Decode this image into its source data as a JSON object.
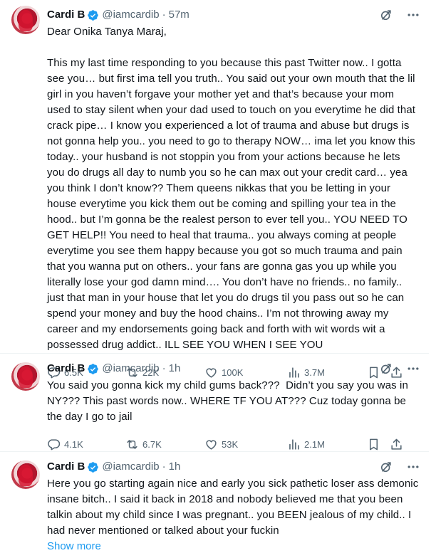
{
  "tweets": [
    {
      "author": "Cardi B",
      "handle": "@iamcardib",
      "separator": "·",
      "time": "57m",
      "text": "Dear Onika Tanya Maraj,\n\nThis my last time responding to you because this past Twitter now.. I gotta see you… but first ima tell you truth.. You said out your own mouth that the lil girl in you haven’t forgave your mother yet and that’s because your mom used to stay silent when your dad used to touch on you everytime he did that crack pipe… I know you experienced a lot of trauma and abuse but drugs is not gonna help you.. you need to go to therapy NOW… ima let you know this today.. your husband is not stoppin you from your actions because he lets you do drugs all day to numb you so he can max out your credit card… yea you think I don’t know?? Them queens nikkas that you be letting in your house everytime you kick them out be coming and spilling your tea in the hood.. but I’m gonna be the realest person to ever tell you.. YOU NEED TO GET HELP!! You need to heal that trauma.. you always coming at people everytime you see them happy because you got so much trauma and pain that you wanna put on others.. your fans are gonna gas you up while you literally lose your god damn mind…. You don’t have no friends.. no family.. just that man in your house that let you do drugs til you pass out so he can spend your money and buy the hood chains.. I’m not throwing away my career and my endorsements going back and forth with wit words wit a possessed drug addict.. ILL SEE YOU WHEN I SEE YOU",
      "show_more": "",
      "replies": "6.5K",
      "reposts": "22K",
      "likes": "100K",
      "views": "3.7M"
    },
    {
      "author": "Cardi B",
      "handle": "@iamcardib",
      "separator": "·",
      "time": "1h",
      "text": "You said you gonna kick my child gums back???  Didn’t you say you was in NY??? This past words now.. WHERE TF YOU AT??? Cuz today gonna be the day I go to jail",
      "show_more": "",
      "replies": "4.1K",
      "reposts": "6.7K",
      "likes": "53K",
      "views": "2.1M"
    },
    {
      "author": "Cardi B",
      "handle": "@iamcardib",
      "separator": "·",
      "time": "1h",
      "text": "Here you go starting again nice and early you sick pathetic loser ass demonic insane bitch.. I said it back in 2018 and nobody believed me that you been talkin about my child since I was pregnant.. you BEEN jealous of my child.. I had never mentioned or talked about your fuckin",
      "show_more": "Show more",
      "replies": "",
      "reposts": "",
      "likes": "",
      "views": ""
    }
  ],
  "icons": {
    "verified": "verified-badge-icon",
    "grok": "grok-icon",
    "more": "more-icon",
    "reply": "reply-icon",
    "repost": "repost-icon",
    "like": "like-icon",
    "views": "views-icon",
    "bookmark": "bookmark-icon",
    "share": "share-icon"
  },
  "colors": {
    "text": "#0f1419",
    "secondary": "#536471",
    "verified": "#1d9bf0",
    "link": "#1d9bf0",
    "divider": "#eff3f4"
  }
}
